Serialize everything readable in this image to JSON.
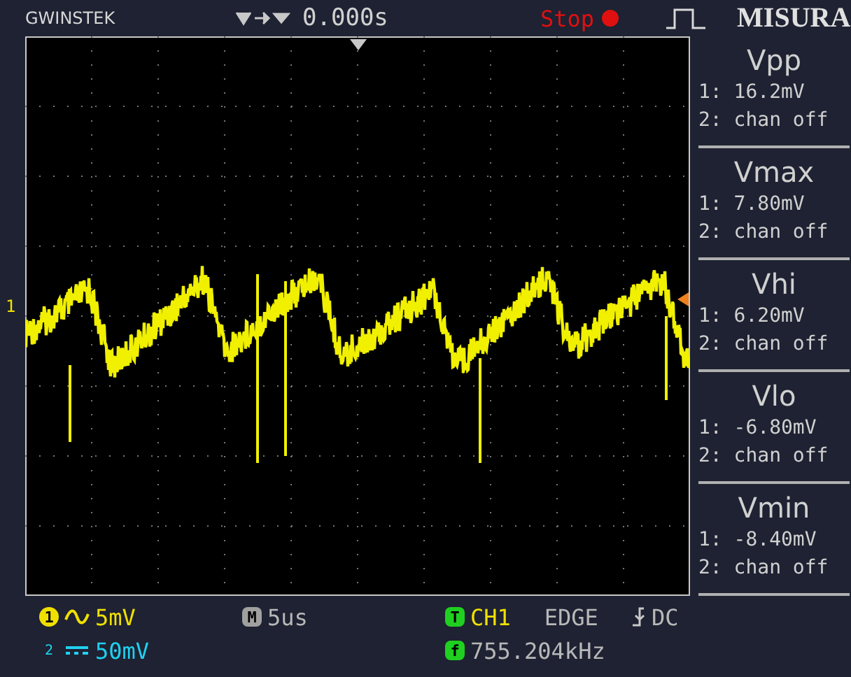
{
  "header": {
    "brand": "GWINSTEK",
    "time_offset": "0.000s",
    "run_state": "Stop",
    "running": false,
    "menu_title": "MISURA"
  },
  "channel_marker": "1",
  "measurements": [
    {
      "name": "Vpp",
      "ch1": "1: 16.2mV",
      "ch2": "2: chan off"
    },
    {
      "name": "Vmax",
      "ch1": "1: 7.80mV",
      "ch2": "2: chan off"
    },
    {
      "name": "Vhi",
      "ch1": "1: 6.20mV",
      "ch2": "2: chan off"
    },
    {
      "name": "Vlo",
      "ch1": "1: -6.80mV",
      "ch2": "2: chan off"
    },
    {
      "name": "Vmin",
      "ch1": "1: -8.40mV",
      "ch2": "2: chan off"
    }
  ],
  "status": {
    "ch1": {
      "badge": "1",
      "scale": "5mV"
    },
    "ch2": {
      "badge": "2",
      "scale": "50mV"
    },
    "timebase": {
      "badge": "M",
      "value": "5us"
    },
    "trigger": {
      "badge": "T",
      "source": "CH1",
      "type": "EDGE",
      "coupling": "DC"
    },
    "frequency": {
      "badge": "f",
      "value": "755.204kHz"
    }
  }
}
